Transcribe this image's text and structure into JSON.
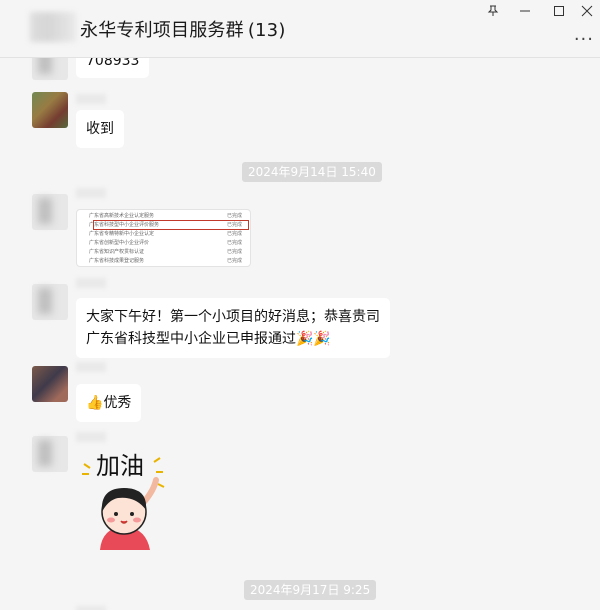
{
  "window": {
    "title": "永华专利项目服务群",
    "member_count": "(13)",
    "pin_icon": "pin-icon",
    "minimize_icon": "minimize-icon",
    "maximize_icon": "maximize-icon",
    "close_icon": "close-icon",
    "more_label": "..."
  },
  "messages": {
    "m0_partial": "708933",
    "m1_text": "收到",
    "time1": "2024年9月14日 15:40",
    "image_rows": [
      {
        "left": "广东省高新技术企业认定服务",
        "right": "已完成"
      },
      {
        "left": "广东省科技型中小企业评价服务",
        "right": "已完成"
      },
      {
        "left": "广东省专精特新中小企业认定",
        "right": "已完成"
      },
      {
        "left": "广东省创新型中小企业评价",
        "right": "已完成"
      },
      {
        "left": "广东省知识产权贯标认证",
        "right": "已完成"
      },
      {
        "left": "广东省科技成果登记服务",
        "right": "已完成"
      }
    ],
    "m3_line1": "大家下午好！第一个小项目的好消息；恭喜贵司",
    "m3_line2": "广东省科技型中小企业已申报通过",
    "m3_emoji": "🎉🎉",
    "m4_emoji": "👍",
    "m4_text": "优秀",
    "sticker_text": "加油",
    "time2": "2024年9月17日 9:25"
  },
  "colors": {
    "background": "#f5f5f5",
    "bubble": "#ffffff",
    "timestamp_bg": "#dadada"
  }
}
